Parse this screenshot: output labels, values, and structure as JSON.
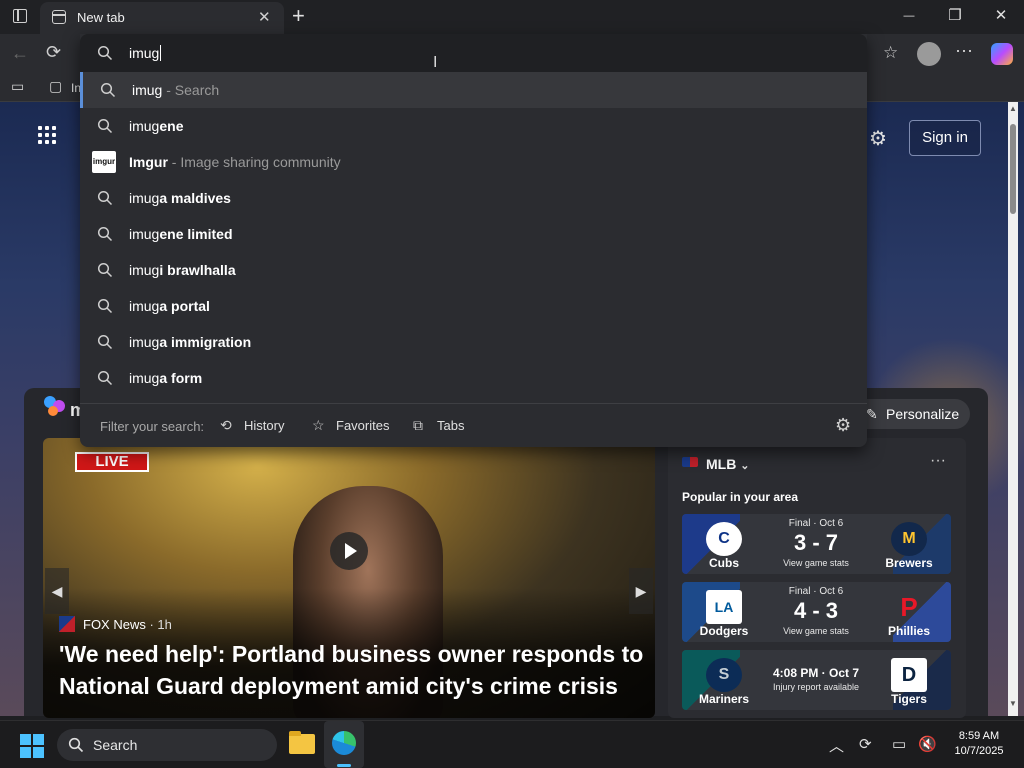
{
  "browser": {
    "tab_title": "New tab",
    "tab_close": "✕",
    "new_tab": "+",
    "window": {
      "minimize": "—",
      "maximize": "❐",
      "close": "✕"
    }
  },
  "favorites_bar": {
    "item_partial": "In"
  },
  "address_bar": {
    "query": "imug"
  },
  "suggestions": [
    {
      "icon": "search-icon",
      "typed": "imug",
      "completion": "",
      "suffix": " - Search",
      "selected": true
    },
    {
      "icon": "search-icon",
      "typed": "imug",
      "completion": "ene",
      "suffix": "",
      "selected": false
    },
    {
      "icon": "imgur-logo",
      "logo_text": "imgur",
      "typed": "Imgur",
      "completion": "",
      "suffix": " - Image sharing community",
      "selected": false
    },
    {
      "icon": "search-icon",
      "typed": "imug",
      "completion": "a maldives",
      "suffix": "",
      "selected": false
    },
    {
      "icon": "search-icon",
      "typed": "imug",
      "completion": "ene limited",
      "suffix": "",
      "selected": false
    },
    {
      "icon": "search-icon",
      "typed": "imug",
      "completion": "i brawlhalla",
      "suffix": "",
      "selected": false
    },
    {
      "icon": "search-icon",
      "typed": "imug",
      "completion": "a portal",
      "suffix": "",
      "selected": false
    },
    {
      "icon": "search-icon",
      "typed": "imug",
      "completion": "a immigration",
      "suffix": "",
      "selected": false
    },
    {
      "icon": "search-icon",
      "typed": "imug",
      "completion": "a form",
      "suffix": "",
      "selected": false
    }
  ],
  "filter": {
    "label": "Filter your search:",
    "history": "History",
    "favorites": "Favorites",
    "tabs": "Tabs"
  },
  "newtab": {
    "sign_in": "Sign in",
    "personalize": "Personalize",
    "brand_partial": "m"
  },
  "hero": {
    "live_badge": "LIVE",
    "source": "FOX News",
    "age": "· 1h",
    "headline": "'We need help': Portland business owner responds to National Guard deployment amid city's crime crisis"
  },
  "mlb": {
    "title": "MLB",
    "subtitle": "Popular in your area",
    "more": "···",
    "games": [
      {
        "status": "Final · Oct 6",
        "score": "3 - 7",
        "link": "View game stats",
        "away": "Cubs",
        "home": "Brewers",
        "away_mark": "C",
        "home_mark": "M",
        "away_color": "#0e3386",
        "home_color": "#12284b"
      },
      {
        "status": "Final · Oct 6",
        "score": "4 - 3",
        "link": "View game stats",
        "away": "Dodgers",
        "home": "Phillies",
        "away_mark": "LA",
        "home_mark": "P",
        "away_color": "#005a9c",
        "home_color": "#284898"
      },
      {
        "status": "4:08 PM · Oct 7",
        "score": "",
        "link": "Injury report available",
        "away": "Mariners",
        "home": "Tigers",
        "away_mark": "S",
        "home_mark": "D",
        "away_color": "#005c5c",
        "home_color": "#0c2340"
      }
    ]
  },
  "taskbar": {
    "search_label": "Search",
    "time": "8:59 AM",
    "date": "10/7/2025"
  }
}
